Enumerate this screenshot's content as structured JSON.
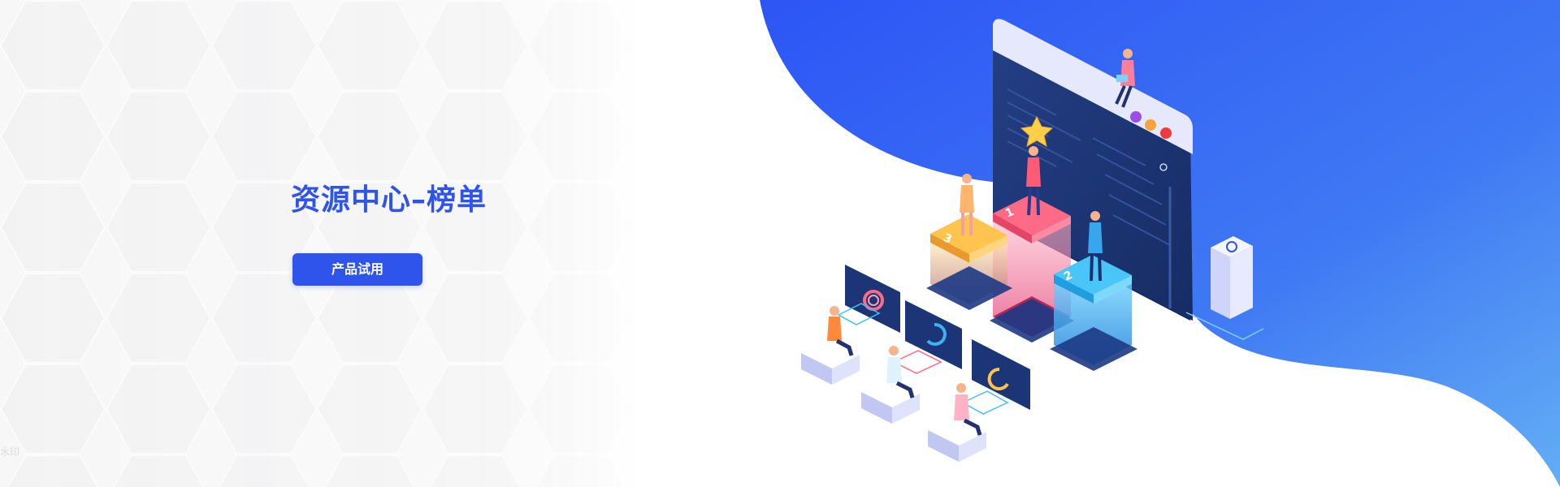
{
  "hero": {
    "title": "资源中心–榜单",
    "cta_label": "产品试用"
  },
  "illustration": {
    "podium_ranks": [
      "1",
      "2",
      "3"
    ]
  },
  "watermark": "水印",
  "colors": {
    "accent": "#2f54eb",
    "wave_top": "#2d55f5",
    "wave_bottom": "#5aa2f5",
    "screen": "#1f3a7a",
    "rank_1": "#ff4f6d",
    "rank_2": "#3fb1f0",
    "rank_3": "#ffc44d"
  },
  "icons": [
    "hexagon-pattern",
    "browser-window",
    "podium",
    "dashboard-card",
    "person-figure",
    "star-icon",
    "server-tower"
  ]
}
